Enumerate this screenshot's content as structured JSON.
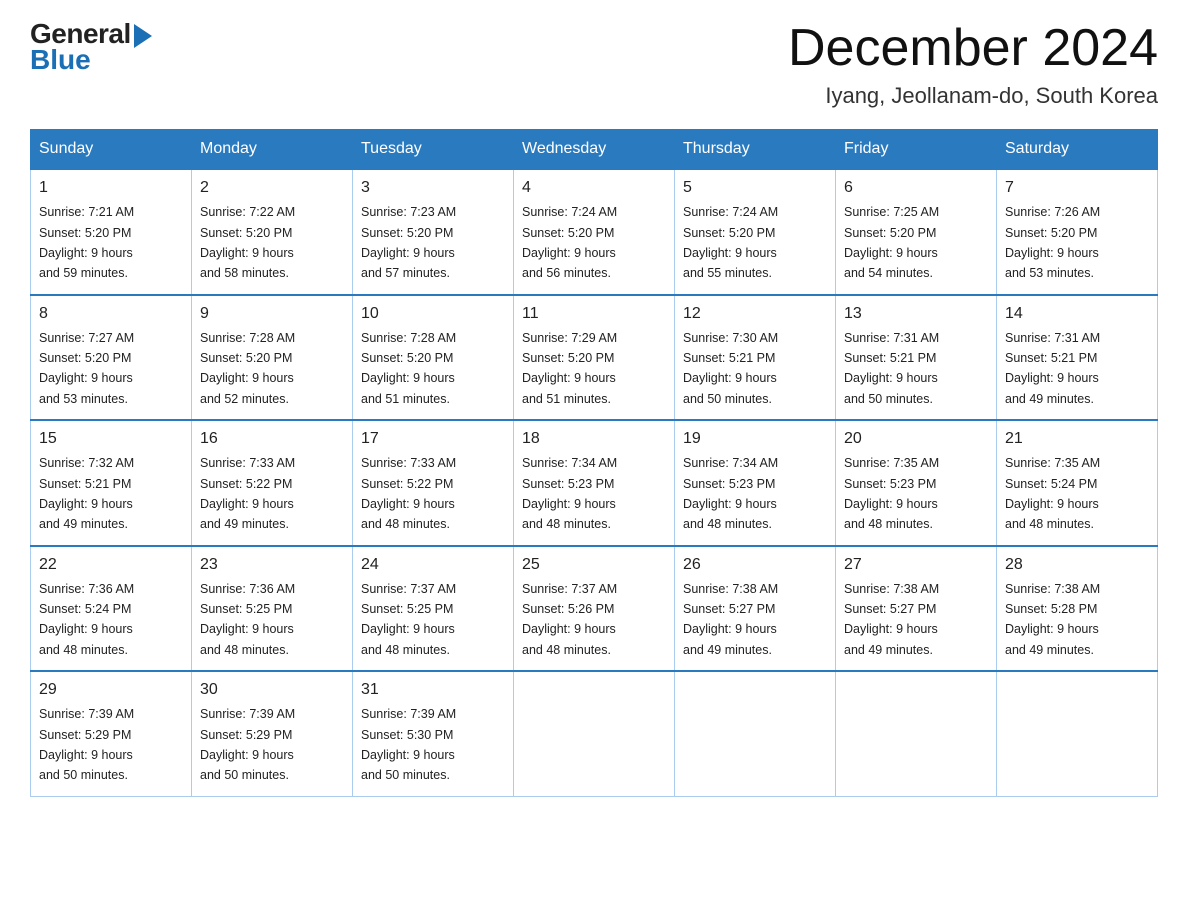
{
  "header": {
    "title": "December 2024",
    "subtitle": "Iyang, Jeollanam-do, South Korea",
    "logo_general": "General",
    "logo_blue": "Blue"
  },
  "weekdays": [
    "Sunday",
    "Monday",
    "Tuesday",
    "Wednesday",
    "Thursday",
    "Friday",
    "Saturday"
  ],
  "weeks": [
    [
      {
        "day": "1",
        "sunrise": "7:21 AM",
        "sunset": "5:20 PM",
        "daylight": "9 hours and 59 minutes."
      },
      {
        "day": "2",
        "sunrise": "7:22 AM",
        "sunset": "5:20 PM",
        "daylight": "9 hours and 58 minutes."
      },
      {
        "day": "3",
        "sunrise": "7:23 AM",
        "sunset": "5:20 PM",
        "daylight": "9 hours and 57 minutes."
      },
      {
        "day": "4",
        "sunrise": "7:24 AM",
        "sunset": "5:20 PM",
        "daylight": "9 hours and 56 minutes."
      },
      {
        "day": "5",
        "sunrise": "7:24 AM",
        "sunset": "5:20 PM",
        "daylight": "9 hours and 55 minutes."
      },
      {
        "day": "6",
        "sunrise": "7:25 AM",
        "sunset": "5:20 PM",
        "daylight": "9 hours and 54 minutes."
      },
      {
        "day": "7",
        "sunrise": "7:26 AM",
        "sunset": "5:20 PM",
        "daylight": "9 hours and 53 minutes."
      }
    ],
    [
      {
        "day": "8",
        "sunrise": "7:27 AM",
        "sunset": "5:20 PM",
        "daylight": "9 hours and 53 minutes."
      },
      {
        "day": "9",
        "sunrise": "7:28 AM",
        "sunset": "5:20 PM",
        "daylight": "9 hours and 52 minutes."
      },
      {
        "day": "10",
        "sunrise": "7:28 AM",
        "sunset": "5:20 PM",
        "daylight": "9 hours and 51 minutes."
      },
      {
        "day": "11",
        "sunrise": "7:29 AM",
        "sunset": "5:20 PM",
        "daylight": "9 hours and 51 minutes."
      },
      {
        "day": "12",
        "sunrise": "7:30 AM",
        "sunset": "5:21 PM",
        "daylight": "9 hours and 50 minutes."
      },
      {
        "day": "13",
        "sunrise": "7:31 AM",
        "sunset": "5:21 PM",
        "daylight": "9 hours and 50 minutes."
      },
      {
        "day": "14",
        "sunrise": "7:31 AM",
        "sunset": "5:21 PM",
        "daylight": "9 hours and 49 minutes."
      }
    ],
    [
      {
        "day": "15",
        "sunrise": "7:32 AM",
        "sunset": "5:21 PM",
        "daylight": "9 hours and 49 minutes."
      },
      {
        "day": "16",
        "sunrise": "7:33 AM",
        "sunset": "5:22 PM",
        "daylight": "9 hours and 49 minutes."
      },
      {
        "day": "17",
        "sunrise": "7:33 AM",
        "sunset": "5:22 PM",
        "daylight": "9 hours and 48 minutes."
      },
      {
        "day": "18",
        "sunrise": "7:34 AM",
        "sunset": "5:23 PM",
        "daylight": "9 hours and 48 minutes."
      },
      {
        "day": "19",
        "sunrise": "7:34 AM",
        "sunset": "5:23 PM",
        "daylight": "9 hours and 48 minutes."
      },
      {
        "day": "20",
        "sunrise": "7:35 AM",
        "sunset": "5:23 PM",
        "daylight": "9 hours and 48 minutes."
      },
      {
        "day": "21",
        "sunrise": "7:35 AM",
        "sunset": "5:24 PM",
        "daylight": "9 hours and 48 minutes."
      }
    ],
    [
      {
        "day": "22",
        "sunrise": "7:36 AM",
        "sunset": "5:24 PM",
        "daylight": "9 hours and 48 minutes."
      },
      {
        "day": "23",
        "sunrise": "7:36 AM",
        "sunset": "5:25 PM",
        "daylight": "9 hours and 48 minutes."
      },
      {
        "day": "24",
        "sunrise": "7:37 AM",
        "sunset": "5:25 PM",
        "daylight": "9 hours and 48 minutes."
      },
      {
        "day": "25",
        "sunrise": "7:37 AM",
        "sunset": "5:26 PM",
        "daylight": "9 hours and 48 minutes."
      },
      {
        "day": "26",
        "sunrise": "7:38 AM",
        "sunset": "5:27 PM",
        "daylight": "9 hours and 49 minutes."
      },
      {
        "day": "27",
        "sunrise": "7:38 AM",
        "sunset": "5:27 PM",
        "daylight": "9 hours and 49 minutes."
      },
      {
        "day": "28",
        "sunrise": "7:38 AM",
        "sunset": "5:28 PM",
        "daylight": "9 hours and 49 minutes."
      }
    ],
    [
      {
        "day": "29",
        "sunrise": "7:39 AM",
        "sunset": "5:29 PM",
        "daylight": "9 hours and 50 minutes."
      },
      {
        "day": "30",
        "sunrise": "7:39 AM",
        "sunset": "5:29 PM",
        "daylight": "9 hours and 50 minutes."
      },
      {
        "day": "31",
        "sunrise": "7:39 AM",
        "sunset": "5:30 PM",
        "daylight": "9 hours and 50 minutes."
      },
      null,
      null,
      null,
      null
    ]
  ],
  "labels": {
    "sunrise": "Sunrise:",
    "sunset": "Sunset:",
    "daylight": "Daylight:"
  }
}
